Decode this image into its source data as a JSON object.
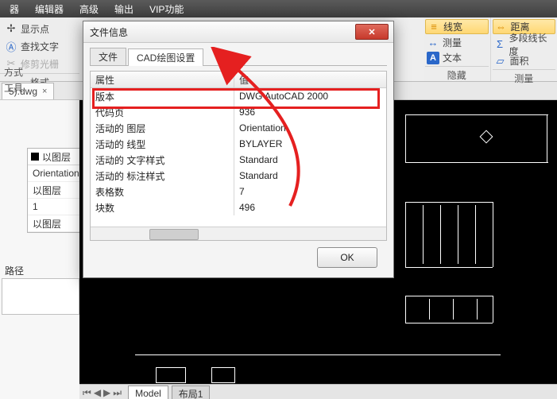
{
  "menu": {
    "items": [
      "器",
      "编辑器",
      "高级",
      "输出",
      "VIP功能"
    ]
  },
  "ribbon": {
    "left": {
      "show_points": "显示点",
      "find_text": "查找文字",
      "trim": "修剪光栅",
      "groups": [
        "格式",
        "方式",
        "工具"
      ]
    },
    "right_col1": {
      "line_width": "线宽",
      "measure": "测量",
      "text": "文本",
      "caption": "隐藏"
    },
    "right_col2": {
      "distance": "距离",
      "polyline_len": "多段线长度",
      "area": "面积",
      "caption": "测量"
    }
  },
  "filetab": {
    "name": "5).dwg",
    "close": "×"
  },
  "layers": {
    "title": "以图层",
    "rows": [
      "Orientation",
      "以图层",
      "1",
      "以图层"
    ]
  },
  "side_path_label": "路径",
  "dialog": {
    "title": "文件信息",
    "close_icon": "✕",
    "tabs": {
      "file": "文件",
      "cad": "CAD绘图设置"
    },
    "header": {
      "prop": "属性",
      "val": "值"
    },
    "rows": [
      {
        "p": "版本",
        "v": "DWG AutoCAD 2000"
      },
      {
        "p": "代码页",
        "v": "936"
      },
      {
        "p": "活动的 图层",
        "v": "Orientation"
      },
      {
        "p": "活动的 线型",
        "v": "BYLAYER"
      },
      {
        "p": "活动的 文字样式",
        "v": "Standard"
      },
      {
        "p": "活动的 标注样式",
        "v": "Standard"
      },
      {
        "p": "表格数",
        "v": "7"
      },
      {
        "p": "块数",
        "v": "496"
      }
    ],
    "ok": "OK"
  },
  "tabs": {
    "model": "Model",
    "layout1": "布局1"
  }
}
